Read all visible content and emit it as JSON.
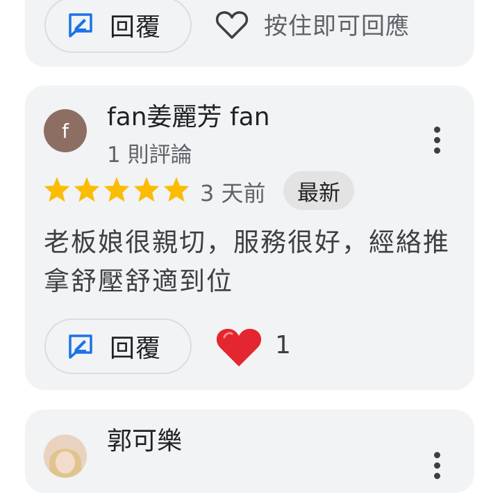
{
  "top_card": {
    "reply_label": "回覆",
    "like_hint": "按住即可回應"
  },
  "review": {
    "avatar_letter": "f",
    "reviewer_name": "fan姜麗芳 fan",
    "review_count": "1 則評論",
    "rating": 5,
    "max_rating": 5,
    "time_ago": "3 天前",
    "badge": "最新",
    "text": "老板娘很親切，服務很好，經絡推拿舒壓舒適到位",
    "reply_label": "回覆",
    "like_count": "1"
  },
  "next_review": {
    "reviewer_name": "郭可樂"
  },
  "colors": {
    "card_bg": "#f1f3f4",
    "star": "#fbbc04",
    "reply_icon": "#1a73e8",
    "heart": "#e3262f",
    "avatar_f": "#8d6e63"
  }
}
